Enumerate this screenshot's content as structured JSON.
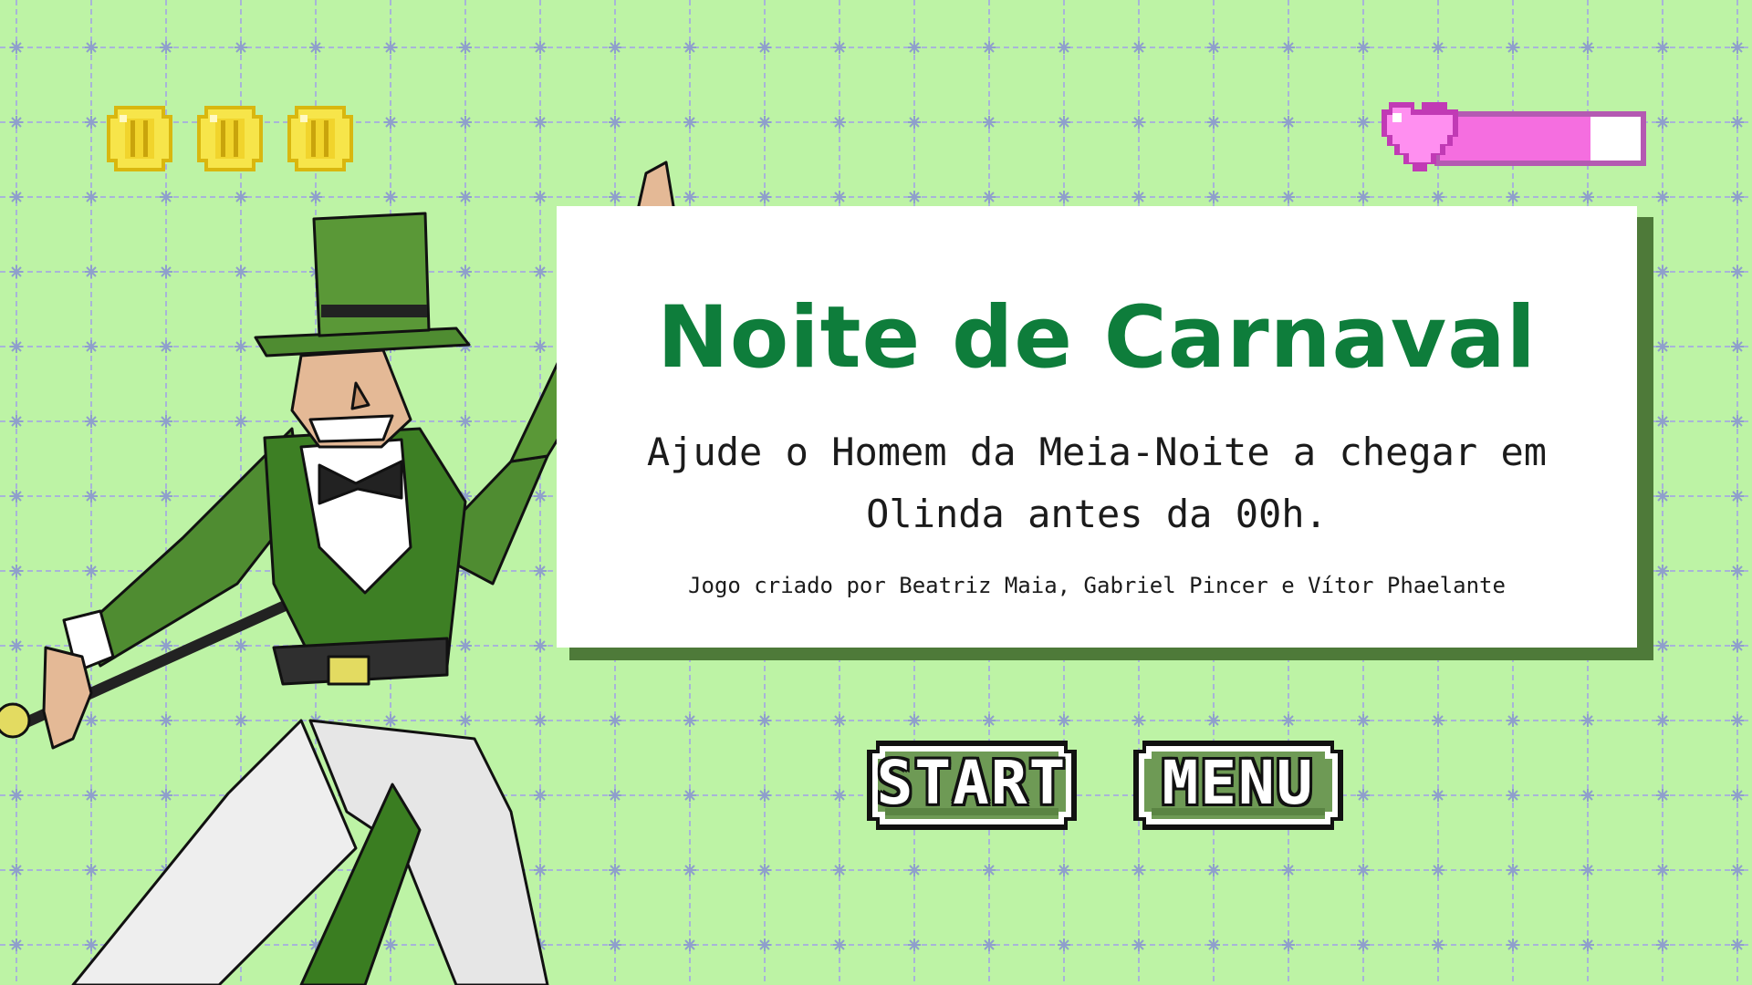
{
  "game": {
    "title": "Noite de Carnaval",
    "subtitle": "Ajude o Homem da Meia-Noite a chegar em Olinda antes da 00h.",
    "credits": "Jogo criado por Beatriz Maia, Gabriel Pincer e Vítor Phaelante"
  },
  "hud": {
    "coins": [
      {
        "icon": "coin-icon"
      },
      {
        "icon": "coin-icon"
      },
      {
        "icon": "coin-icon"
      }
    ],
    "health": {
      "icon": "heart-icon",
      "fill_fraction": 0.75,
      "fill_color": "#f56ee0",
      "border_color": "#b45ab2"
    }
  },
  "buttons": {
    "start_label": "START",
    "menu_label": "MENU",
    "button_color": "#6e9a55"
  },
  "colors": {
    "background": "#bdf3a5",
    "grid_lines": "#a8b4d8",
    "title": "#0e7d3b",
    "card_shadow": "#4e7a39"
  },
  "character": {
    "name": "homem-da-meia-noite",
    "icon": "mascot-figure"
  }
}
